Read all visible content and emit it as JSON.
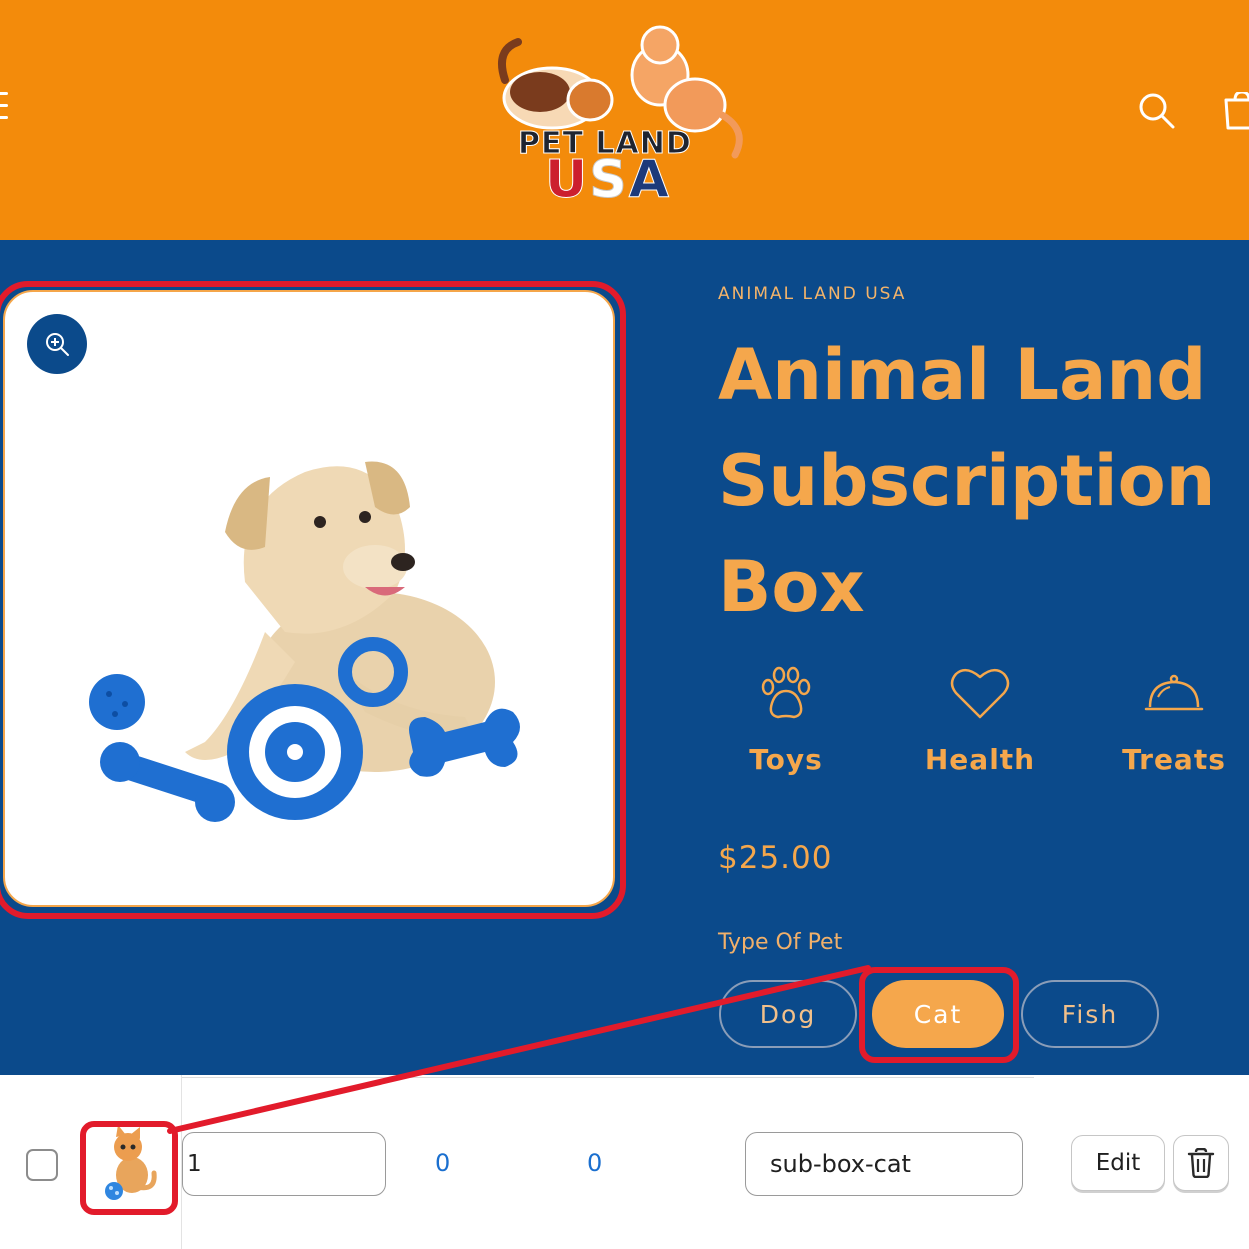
{
  "header": {
    "logo_line1": "PET LAND",
    "logo_usa_u": "U",
    "logo_usa_s": "S",
    "logo_usa_a": "A",
    "menu_icon": "menu-icon",
    "search_icon": "search-icon",
    "cart_icon": "cart-icon",
    "background_color": "#F38B0B"
  },
  "product": {
    "vendor": "ANIMAL LAND USA",
    "title": "Animal Land Subscription Box",
    "features": [
      {
        "label": "Toys",
        "icon": "paw-icon"
      },
      {
        "label": "Health",
        "icon": "heart-icon"
      },
      {
        "label": "Treats",
        "icon": "cloche-icon"
      }
    ],
    "price": "$25.00",
    "option_label": "Type Of Pet",
    "options": [
      {
        "label": "Dog",
        "selected": false
      },
      {
        "label": "Cat",
        "selected": true
      },
      {
        "label": "Fish",
        "selected": false
      }
    ],
    "background_color": "#0B4A8B",
    "accent_color": "#F5A74C"
  },
  "admin_row": {
    "quantity": "1",
    "value_1": "0",
    "value_2": "0",
    "sku": "sub-box-cat",
    "edit_label": "Edit",
    "delete_icon": "trash-icon",
    "checked": false
  },
  "annotations": {
    "highlight_color": "#E21B2B"
  }
}
